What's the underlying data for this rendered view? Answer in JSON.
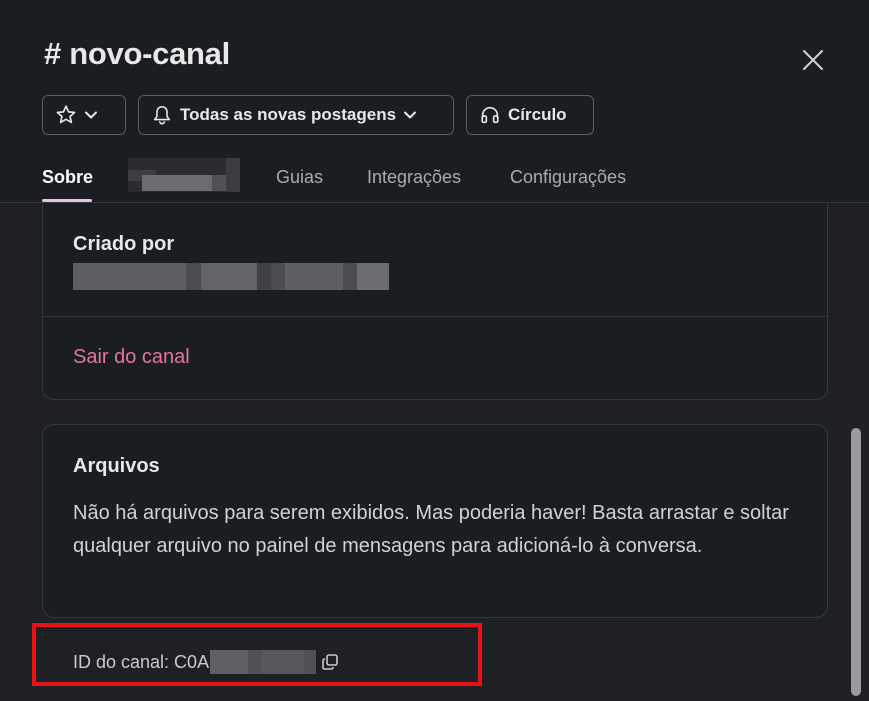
{
  "header": {
    "channel_hash": "#",
    "channel_name": "novo-canal"
  },
  "buttons": {
    "notifications_label": "Todas as novas postagens",
    "huddle_label": "Círculo"
  },
  "tabs": [
    {
      "label": "Sobre",
      "active": true
    },
    {
      "label": "Guias",
      "active": false
    },
    {
      "label": "Integrações",
      "active": false
    },
    {
      "label": "Configurações",
      "active": false
    }
  ],
  "about": {
    "created_by_label": "Criado por",
    "leave_label": "Sair do canal"
  },
  "files": {
    "title": "Arquivos",
    "empty_text": "Não há arquivos para serem exibidos. Mas poderia haver! Basta arrastar e soltar qualquer arquivo no painel de mensagens para adicioná-lo à conversa."
  },
  "channel_id": {
    "label": "ID do canal: C0A"
  },
  "colors": {
    "background": "#1a1d21",
    "accent_tab": "#e8c1e0",
    "leave_link": "#e8739f",
    "highlight_box": "#e5121a"
  },
  "icons": [
    "star-icon",
    "chevron-down-icon",
    "bell-icon",
    "headphones-icon",
    "close-icon",
    "copy-icon"
  ]
}
